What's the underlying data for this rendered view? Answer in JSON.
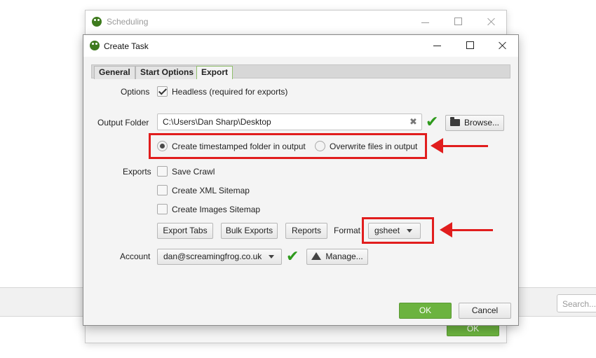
{
  "background": {
    "search_placeholder": "Search..."
  },
  "scheduling_window": {
    "title": "Scheduling",
    "ok_label": "OK"
  },
  "dialog": {
    "title": "Create Task",
    "tabs": [
      {
        "label": "General",
        "active": false
      },
      {
        "label": "Start Options",
        "active": false
      },
      {
        "label": "Export",
        "active": true
      }
    ],
    "options": {
      "label": "Options",
      "headless_label": "Headless (required for exports)",
      "headless_checked": true
    },
    "output_folder": {
      "label": "Output Folder",
      "value": "C:\\Users\\Dan Sharp\\Desktop",
      "clear_glyph": "✖",
      "valid_glyph": "✔",
      "browse_label": "Browse..."
    },
    "folder_mode": {
      "timestamped_label": "Create timestamped folder in output",
      "timestamped_selected": true,
      "overwrite_label": "Overwrite files in output",
      "overwrite_selected": false
    },
    "exports": {
      "label": "Exports",
      "save_crawl_label": "Save Crawl",
      "save_crawl_checked": false,
      "xml_sitemap_label": "Create XML Sitemap",
      "xml_sitemap_checked": false,
      "images_sitemap_label": "Create Images Sitemap",
      "images_sitemap_checked": false,
      "export_tabs_label": "Export Tabs",
      "bulk_exports_label": "Bulk Exports",
      "reports_label": "Reports",
      "format_label": "Format",
      "format_value": "gsheet"
    },
    "account": {
      "label": "Account",
      "value": "dan@screamingfrog.co.uk",
      "valid_glyph": "✔",
      "manage_label": "Manage..."
    },
    "ok_label": "OK",
    "cancel_label": "Cancel"
  },
  "colors": {
    "accent_green": "#6cb33f",
    "check_green": "#2e9a1c",
    "annotation_red": "#e11d1d"
  },
  "icons": [
    "frog-logo-icon",
    "minimize-icon",
    "maximize-icon",
    "close-icon",
    "folder-icon",
    "google-drive-icon",
    "checkmark-icon",
    "chevron-down-icon"
  ]
}
